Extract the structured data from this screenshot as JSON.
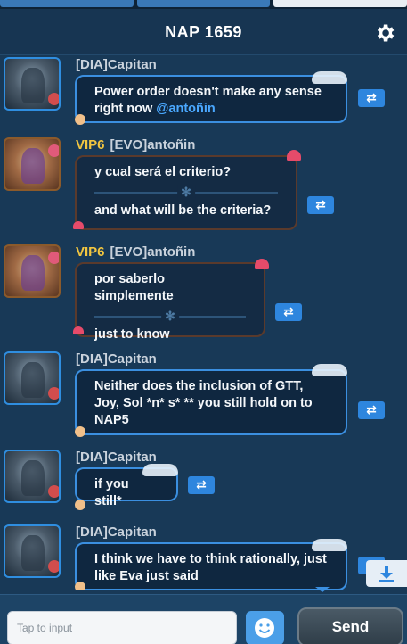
{
  "header": {
    "title": "NAP 1659"
  },
  "icons": {
    "settings": "gear-icon",
    "translate": "swap-arrows-icon",
    "download": "download-icon",
    "emoji": "smiley-icon"
  },
  "messages": [
    {
      "vip": "",
      "author": "[DIA]Capitan",
      "text": "Power order doesn't make any sense right now ",
      "mention": "@antoñin"
    },
    {
      "vip": "VIP6",
      "author": "[EVO]antoñin",
      "original": "y cual será el criterio?",
      "translation": "and what will be the criteria?"
    },
    {
      "vip": "VIP6",
      "author": "[EVO]antoñin",
      "original": "por saberlo simplemente",
      "translation": "just to know"
    },
    {
      "vip": "",
      "author": "[DIA]Capitan",
      "text": "Neither does the inclusion of GTT, Joy, Sol *n* s* ** you still hold on to NAP5"
    },
    {
      "vip": "",
      "author": "[DIA]Capitan",
      "text": "if you still*"
    },
    {
      "vip": "",
      "author": "[DIA]Capitan",
      "text": "I think we have to think rationally, just like Eva just said"
    }
  ],
  "translate_label": "⇄",
  "input": {
    "placeholder": "Tap to input"
  },
  "send": {
    "label": "Send"
  },
  "colors": {
    "accent": "#3b8fe0",
    "vip": "#f2c640",
    "mention": "#4aa8ff",
    "background": "#183957"
  }
}
